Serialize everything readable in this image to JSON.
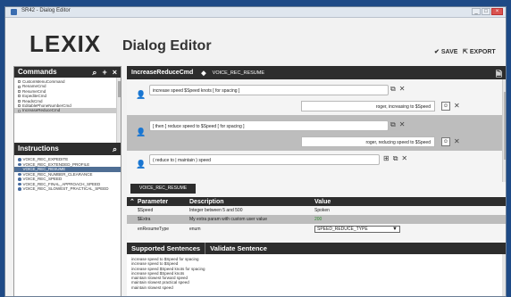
{
  "window": {
    "title": "SR42 - Dialog Editor",
    "min": "_",
    "max": "□",
    "close": "×"
  },
  "header": {
    "logo_left": "LE",
    "logo_x": "X",
    "logo_right": "IX",
    "app_title": "Dialog Editor",
    "save_label": "SAVE",
    "export_label": "EXPORT"
  },
  "commands": {
    "title": "Commands",
    "items": [
      {
        "label": "CustomMenuCommand",
        "selected": false
      },
      {
        "label": "RenameCmd",
        "selected": false
      },
      {
        "label": "ResumeCmd",
        "selected": false
      },
      {
        "label": "ExpediteCmd",
        "selected": false
      },
      {
        "label": "ReadsCmd",
        "selected": false
      },
      {
        "label": "EditablePhoneNumberCmd",
        "selected": false
      },
      {
        "label": "IncreaseReduceCmd",
        "selected": true
      }
    ]
  },
  "instructions": {
    "title": "Instructions",
    "items": [
      {
        "label": "VOICE_REC_EXPEDITE",
        "selected": false
      },
      {
        "label": "VOICE_REC_EXTENDED_PROFILE",
        "selected": false
      },
      {
        "label": "VOICE_REC_RESUME",
        "selected": true
      },
      {
        "label": "VOICE_REC_NUMBER_CLEARANCE",
        "selected": false
      },
      {
        "label": "VOICE_REC_SPEED",
        "selected": false
      },
      {
        "label": "VOICE_REC_FINAL_APPROACH_SPEED",
        "selected": false
      },
      {
        "label": "VOICE_REC_SLOWEST_PRACTICAL_SPEED",
        "selected": false
      }
    ]
  },
  "editor": {
    "command_name": "IncreaseReduceCmd",
    "arrow": "◆",
    "instruction_name": "VOICE_REC_RESUME",
    "sentences": [
      {
        "text": "increase speed $Speed knots [ for spacing ]",
        "response": "roger, increasing to $Speed"
      },
      {
        "text": "[ then ] reduce speed to $Speed [ for spacing ]",
        "response": "roger, reducing speed to $Speed"
      },
      {
        "text": "( reduce to | maintain ) speed",
        "response": ""
      }
    ]
  },
  "params": {
    "tab_label": "VOICE_REC_RESUME",
    "headers": {
      "parameter": "Parameter",
      "description": "Description",
      "value": "Value"
    },
    "rows": [
      {
        "parameter": "$Speed",
        "description": "Integer between 5 and 500",
        "value": "Spoken"
      },
      {
        "parameter": "$Extra",
        "description": "My extra param with custom user value",
        "value": "200"
      },
      {
        "parameter": "enResumeType",
        "description": "enum",
        "value": "SPEED_REDUCE_TYPE"
      }
    ]
  },
  "bottom_tabs": {
    "supported": "Supported Sentences",
    "validate": "Validate Sentence"
  },
  "supported_sentences": [
    "increase speed to $Speed for spacing",
    "increase speed to $Speed",
    "increase speed $Speed knots for spacing",
    "increase speed $Speed knots",
    "maintain slowest forward speed",
    "maintain slowest practical speed",
    "maintain slowest speed"
  ],
  "colors": {
    "selected_instruction": "#4f6e94",
    "dark_bar": "#2d2d2d",
    "desktop": "#1e4a86"
  }
}
